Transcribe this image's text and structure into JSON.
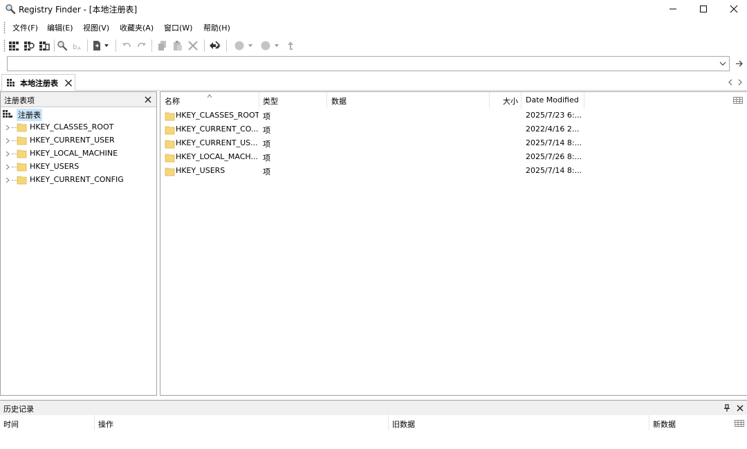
{
  "window": {
    "title": "Registry Finder - [本地注册表]"
  },
  "menu": [
    "文件(F)",
    "编辑(E)",
    "视图(V)",
    "收藏夹(A)",
    "窗口(W)",
    "帮助(H)"
  ],
  "address": {
    "value": "",
    "placeholder": ""
  },
  "tab": {
    "label": "本地注册表"
  },
  "left_pane": {
    "title": "注册表项",
    "root_label": "注册表",
    "items": [
      "HKEY_CLASSES_ROOT",
      "HKEY_CURRENT_USER",
      "HKEY_LOCAL_MACHINE",
      "HKEY_USERS",
      "HKEY_CURRENT_CONFIG"
    ]
  },
  "list": {
    "columns": [
      "名称",
      "类型",
      "数据",
      "大小",
      "Date Modified"
    ],
    "rows": [
      {
        "name": "HKEY_CLASSES_ROOT",
        "type": "项",
        "date": "2025/7/23 6:..."
      },
      {
        "name": "HKEY_CURRENT_CO...",
        "type": "项",
        "date": "2022/4/16 2..."
      },
      {
        "name": "HKEY_CURRENT_US...",
        "type": "项",
        "date": "2025/7/14 8:..."
      },
      {
        "name": "HKEY_LOCAL_MACH...",
        "type": "项",
        "date": "2025/7/26 8:..."
      },
      {
        "name": "HKEY_USERS",
        "type": "项",
        "date": "2025/7/14 8:..."
      }
    ]
  },
  "history": {
    "title": "历史记录",
    "columns": [
      "时间",
      "操作",
      "旧数据",
      "新数据"
    ]
  },
  "icons": {
    "app": "magnifier-icon",
    "folder_color": "#f5d77a",
    "folder_edge": "#d9b54c",
    "selection_color": "#cce4f7"
  }
}
